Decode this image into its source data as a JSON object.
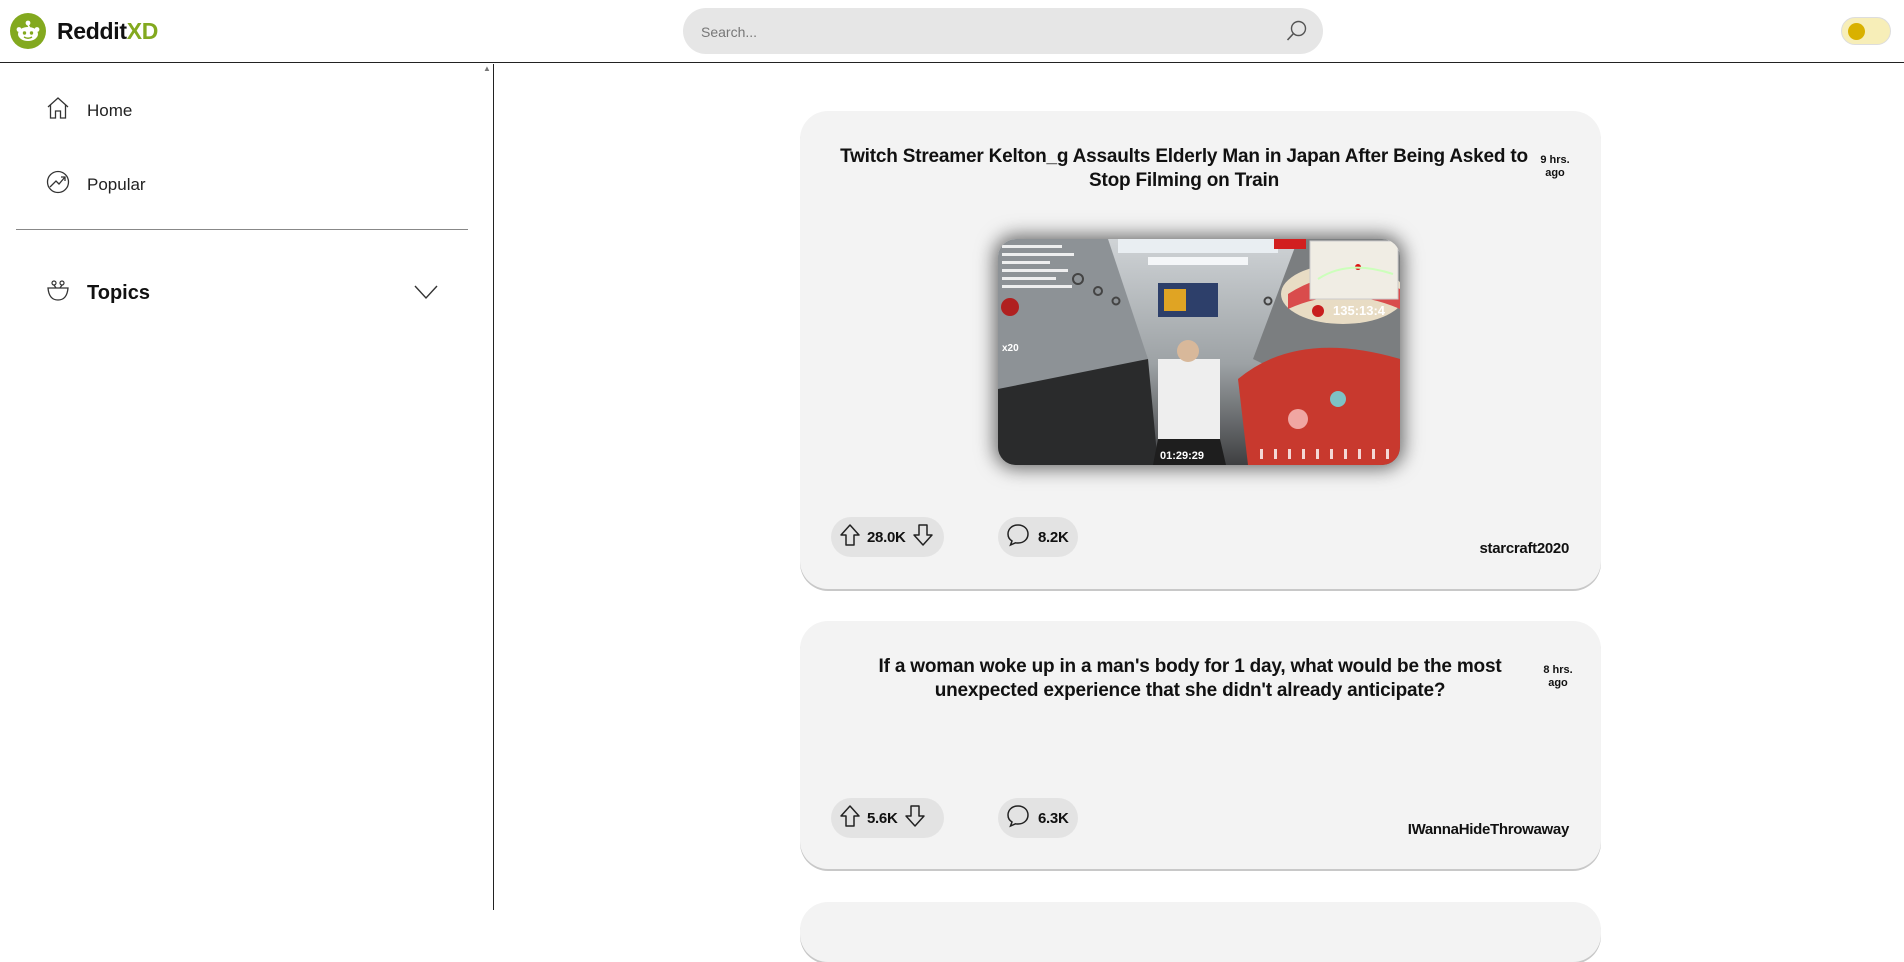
{
  "app": {
    "name_main": "Reddit",
    "name_accent": "XD",
    "brand_color": "#83a91f"
  },
  "search": {
    "placeholder": "Search..."
  },
  "theme_toggle": {
    "state": "light"
  },
  "sidebar": {
    "nav": [
      {
        "label": "Home",
        "icon": "home-icon"
      },
      {
        "label": "Popular",
        "icon": "popular-icon"
      }
    ],
    "topics": {
      "label": "Topics",
      "icon": "topics-icon",
      "expanded": false
    }
  },
  "posts": [
    {
      "title": "Twitch Streamer Kelton_g Assaults Elderly Man in Japan After Being Asked to Stop Filming on Train",
      "time": "9 hrs. ago",
      "has_media": true,
      "media_timer": "135:13:4",
      "media_timestamp": "01:29:29",
      "media_badge": "x20",
      "score": "28.0K",
      "comments": "8.2K",
      "author": "starcraft2020"
    },
    {
      "title": "If a woman woke up in a man's body for 1 day, what would be the most unexpected experience that she didn't already anticipate?",
      "time": "8 hrs. ago",
      "has_media": false,
      "score": "5.6K",
      "comments": "6.3K",
      "author": "IWannaHideThrowaway"
    }
  ]
}
